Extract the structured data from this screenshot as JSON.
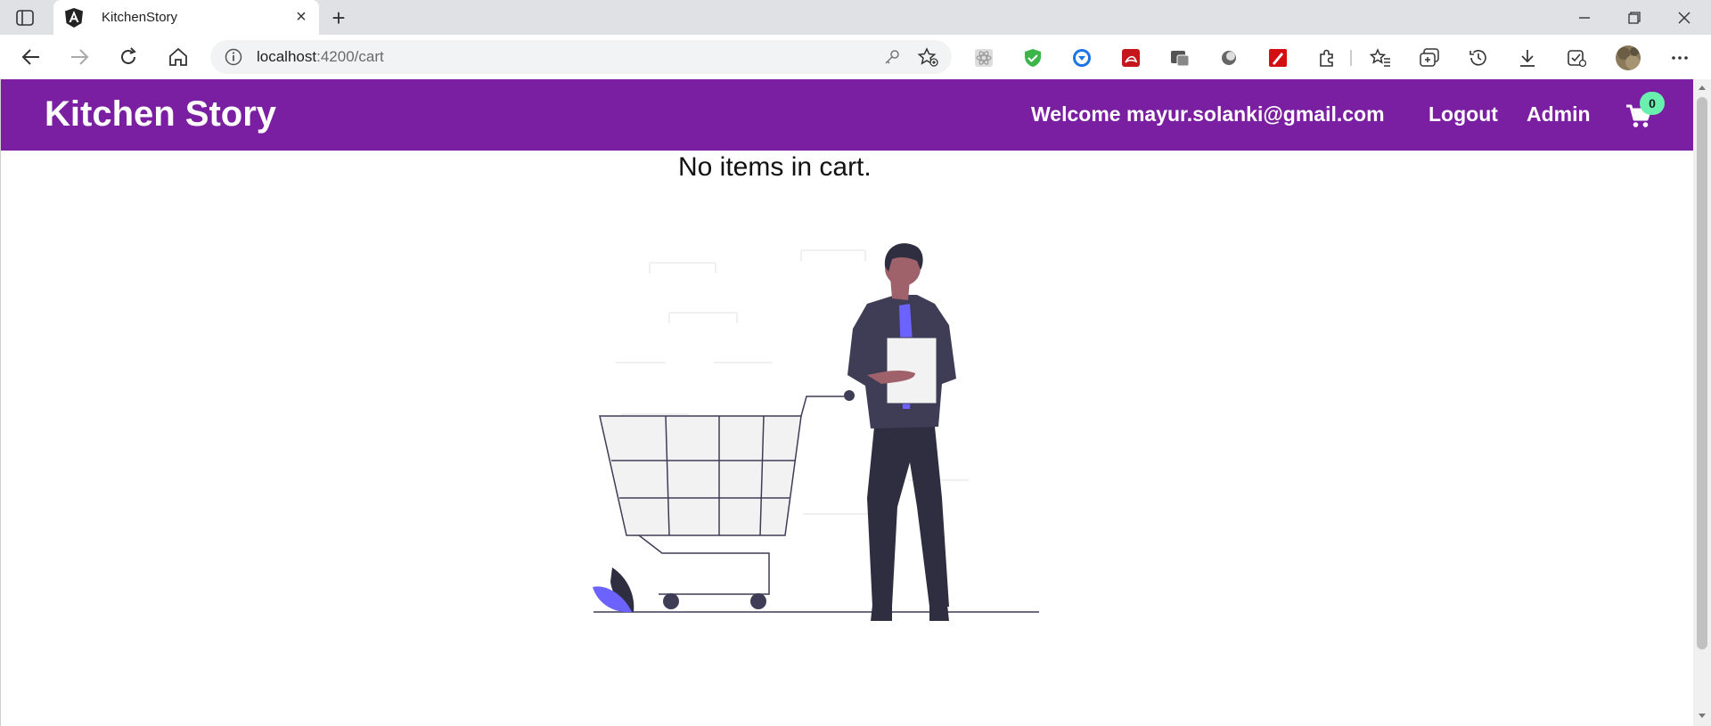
{
  "browser": {
    "tab_title": "KitchenStory",
    "new_tab_symbol": "+",
    "close_symbol": "×",
    "url_host": "localhost",
    "url_path": ":4200/cart",
    "icons": [
      "sidebar-icon",
      "angular-icon",
      "back-icon",
      "forward-icon",
      "reload-icon",
      "home-icon",
      "info-icon",
      "key-icon",
      "add-favorite-icon",
      "react-devtools-icon",
      "shield-icon",
      "download-icon",
      "pdf-icon",
      "capture-icon",
      "circle-icon",
      "pen-icon",
      "extensions-icon",
      "favorites-icon",
      "collections-icon",
      "history-icon",
      "downloads-icon",
      "performance-icon",
      "profile-avatar",
      "more-icon",
      "minimize-icon",
      "restore-icon",
      "close-icon"
    ]
  },
  "navbar": {
    "brand": "Kitchen Story",
    "welcome": "Welcome mayur.solanki@gmail.com",
    "logout": "Logout",
    "admin": "Admin",
    "cart_count": "0",
    "color": "#7b1fa2",
    "badge_color": "#69f0ae"
  },
  "main": {
    "empty_message": "No items in cart."
  }
}
